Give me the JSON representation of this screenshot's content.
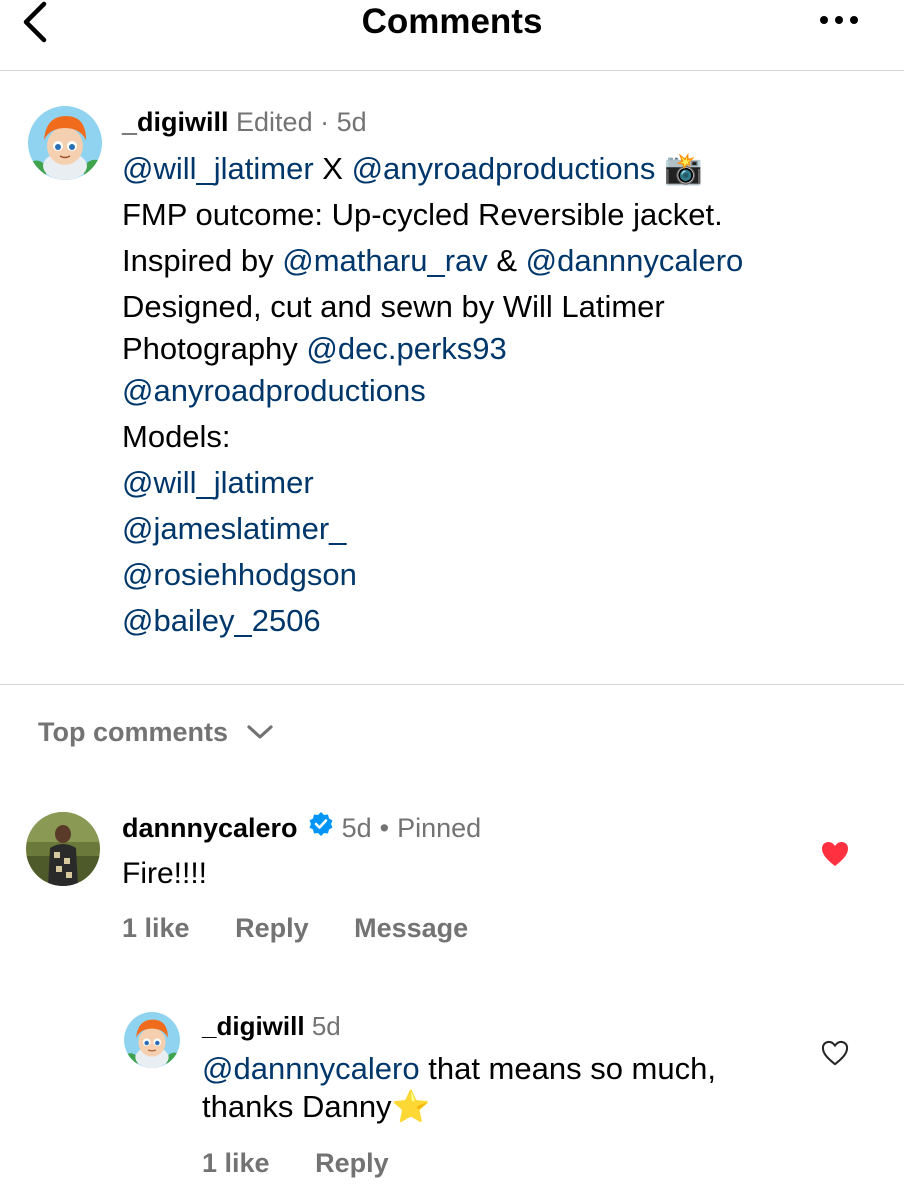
{
  "header": {
    "title": "Comments",
    "back_icon": "chevron-left-icon",
    "more_icon": "more-horizontal-icon"
  },
  "caption": {
    "username": "_digiwill",
    "edited": "Edited",
    "separator": "·",
    "time": "5d",
    "lines": {
      "l1_m1": "@will_jlatimer",
      "l1_t1": " X ",
      "l1_m2": "@anyroadproductions",
      "l1_emoji": "📸",
      "l2": "FMP outcome: Up-cycled Reversible jacket.",
      "l3_t1": "Inspired by ",
      "l3_m1": "@matharu_rav",
      "l3_t2": " & ",
      "l3_m2": "@dannnycalero",
      "l4": "Designed, cut and sewn by Will Latimer",
      "l5_t1": "Photography ",
      "l5_m1": "@dec.perks93",
      "l6_m1": "@anyroadproductions",
      "l7": "Models:",
      "l8_m1": "@will_jlatimer",
      "l9_m1": "@jameslatimer_",
      "l10_m1": "@rosiehhodgson",
      "l11_m1": "@bailey_2506"
    }
  },
  "sort": {
    "label": "Top comments",
    "icon": "chevron-down-icon"
  },
  "comments": [
    {
      "username": "dannnycalero",
      "verified_icon": "verified-badge-icon",
      "time": "5d",
      "separator": "•",
      "pinned": "Pinned",
      "text": "Fire!!!!",
      "likes": "1 like",
      "reply": "Reply",
      "message": "Message",
      "heart_color": "#ff3040",
      "liked": true
    },
    {
      "username": "_digiwill",
      "time": "5d",
      "mention": "@dannnycalero",
      "text_part1": " that means so much,",
      "text_part2": "thanks Danny",
      "emoji": "⭐",
      "likes": "1 like",
      "reply": "Reply",
      "liked": false
    }
  ],
  "colors": {
    "mention": "#00376b",
    "meta": "#737373",
    "verified": "#0095f6"
  }
}
